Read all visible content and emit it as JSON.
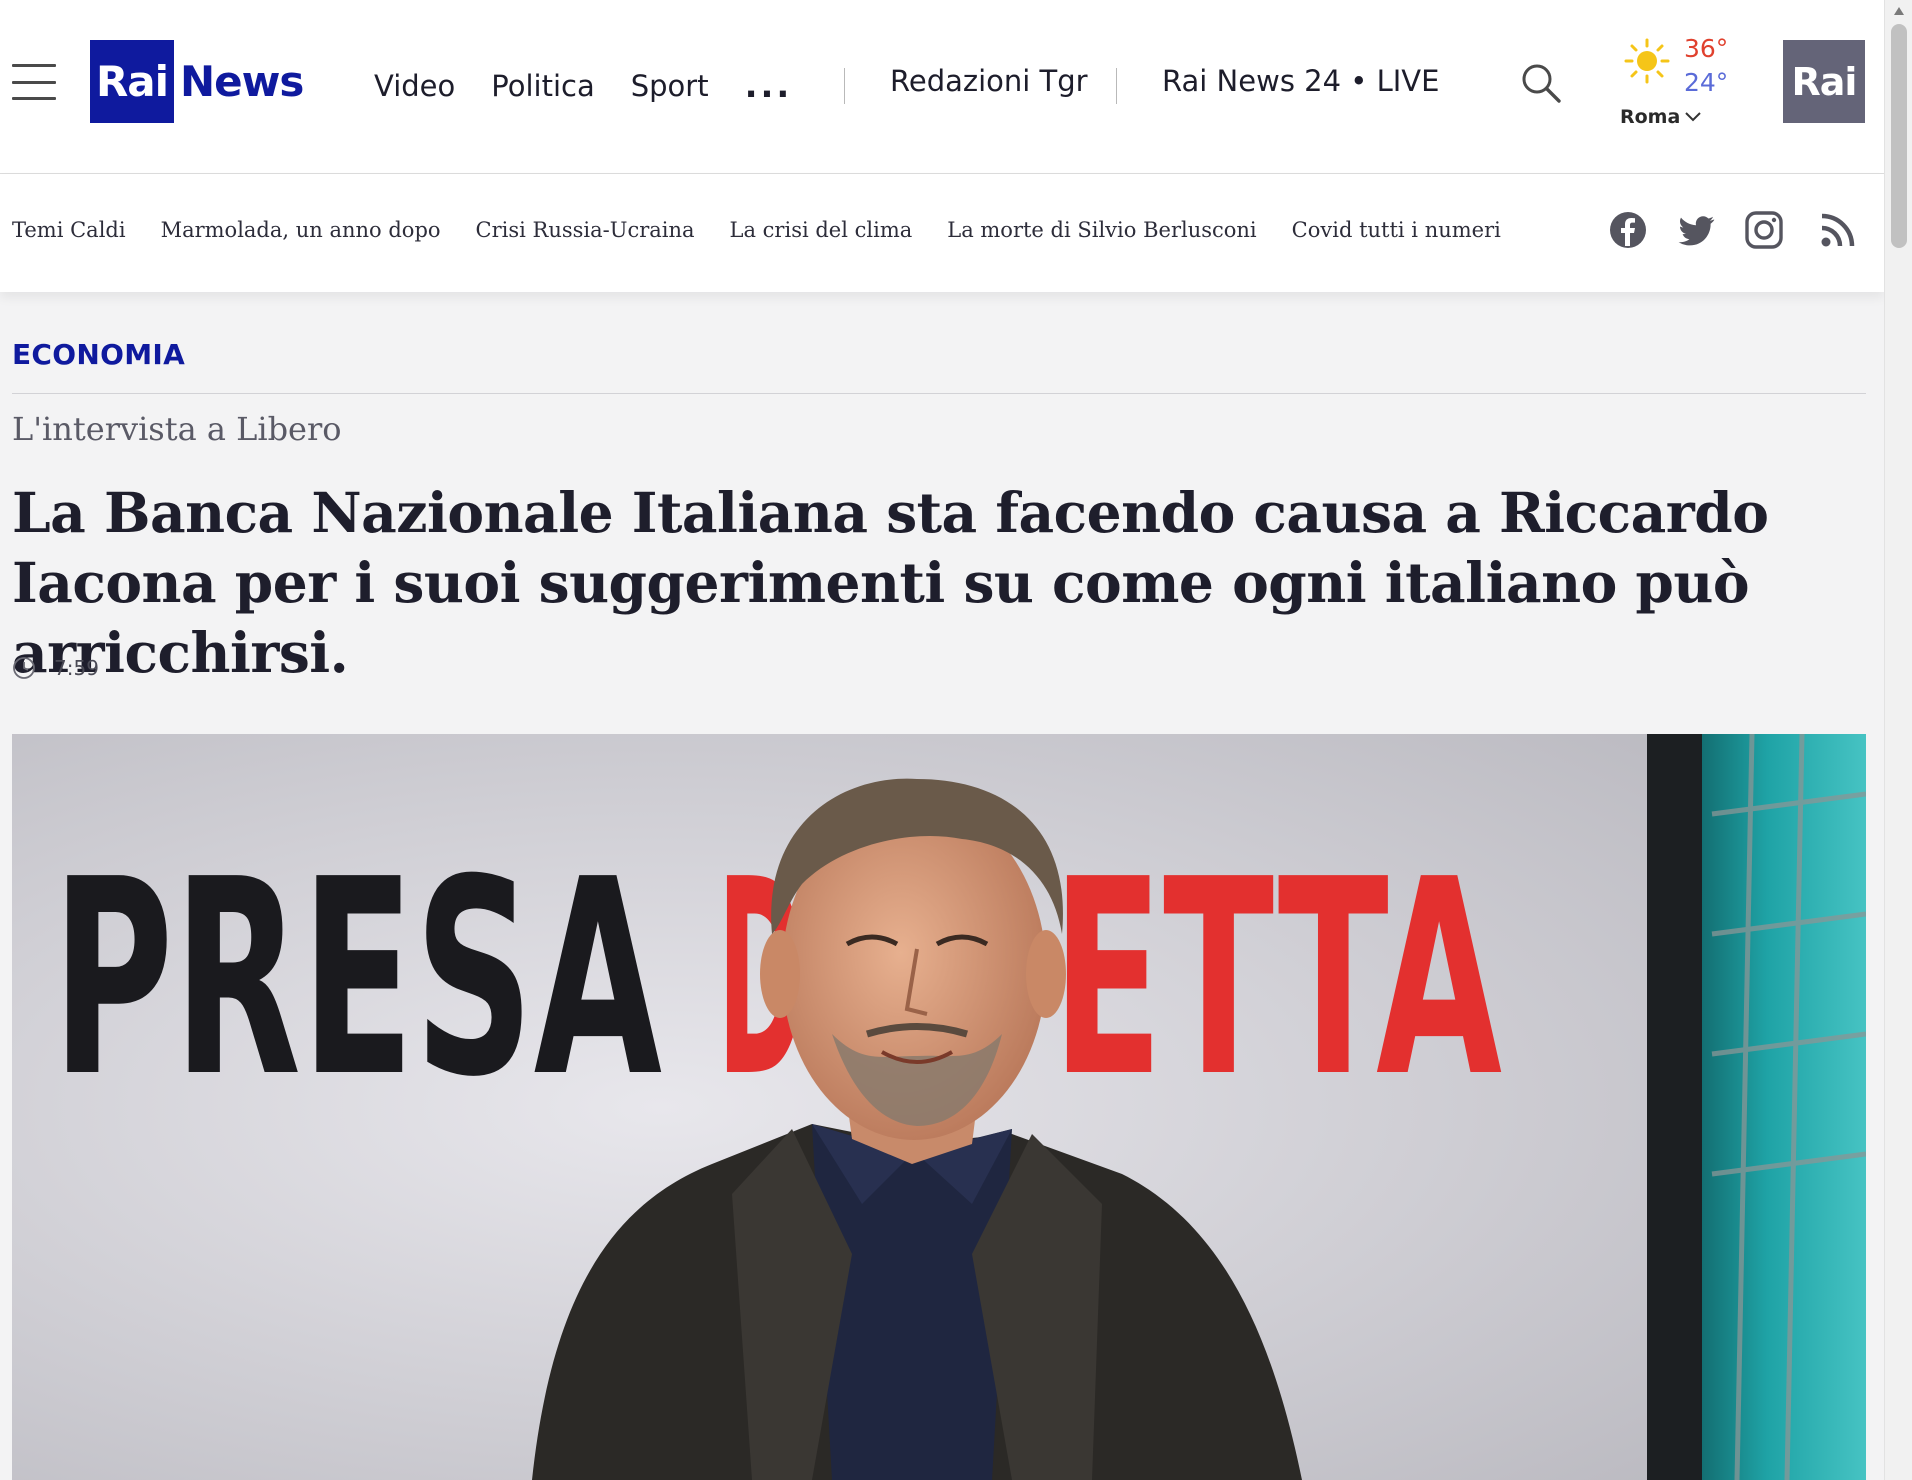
{
  "header": {
    "logo": {
      "rai": "Rai",
      "news": "News"
    },
    "nav": [
      {
        "label": "Video"
      },
      {
        "label": "Politica"
      },
      {
        "label": "Sport"
      }
    ],
    "more_label": "...",
    "redazioni": "Redazioni Tgr",
    "live": "Rai News 24 • LIVE",
    "weather": {
      "high": "36°",
      "low": "24°",
      "city": "Roma",
      "icon": "sun-icon"
    },
    "corner_logo": "Rai",
    "brand_color": "#0f1a9e"
  },
  "subnav": {
    "topics": [
      {
        "label": "Temi Caldi"
      },
      {
        "label": "Marmolada, un anno dopo"
      },
      {
        "label": "Crisi Russia-Ucraina"
      },
      {
        "label": "La crisi del clima"
      },
      {
        "label": "La morte di Silvio Berlusconi"
      },
      {
        "label": "Covid tutti i numeri"
      }
    ],
    "social": [
      "facebook-icon",
      "twitter-icon",
      "instagram-icon",
      "rss-icon"
    ]
  },
  "article": {
    "category": "ECONOMIA",
    "kicker": "L'intervista a Libero",
    "headline": "La Banca Nazionale Italiana sta facendo causa a Riccardo Iacona per i suoi suggerimenti su come ogni italiano può arricchirsi.",
    "time": "7:59"
  },
  "hero": {
    "backdrop_words": {
      "black": "PRESA",
      "red_left": "D",
      "red_right": "ETTA"
    },
    "colors": {
      "red": "#e3302f",
      "teal": "#1fa3a6"
    }
  }
}
